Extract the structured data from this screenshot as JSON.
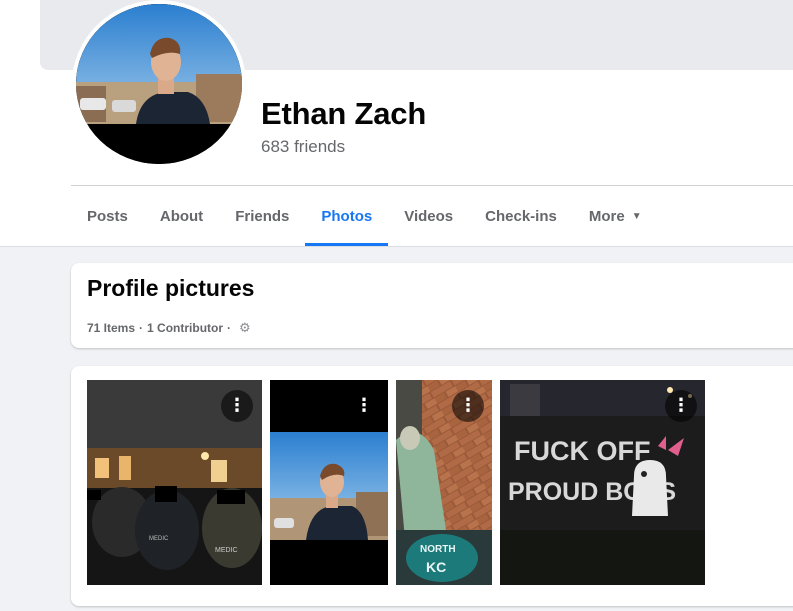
{
  "profile": {
    "name": "Ethan Zach",
    "friends_text": "683 friends"
  },
  "tabs": [
    {
      "label": "Posts",
      "active": false
    },
    {
      "label": "About",
      "active": false
    },
    {
      "label": "Friends",
      "active": false
    },
    {
      "label": "Photos",
      "active": true
    },
    {
      "label": "Videos",
      "active": false
    },
    {
      "label": "Check-ins",
      "active": false
    },
    {
      "label": "More",
      "active": false
    }
  ],
  "album": {
    "title": "Profile pictures",
    "items": "71 Items",
    "separator": "·",
    "contributors": "1 Contributor",
    "gear_icon": "gear-icon"
  },
  "photo_texts": {
    "photo1_patch1": "MEDIC",
    "photo1_patch2": "MEDIC",
    "photo3_logo_top": "NORTH",
    "photo3_logo_bottom": "KC",
    "banner_line1": "FUCK OFF",
    "banner_line2": "PROUD BOYS"
  },
  "icons": {
    "more_caret": "▼",
    "photo_options": "⋮"
  },
  "colors": {
    "accent": "#1877f2",
    "secondary_text": "#65676b",
    "page_bg": "#f0f2f5"
  }
}
